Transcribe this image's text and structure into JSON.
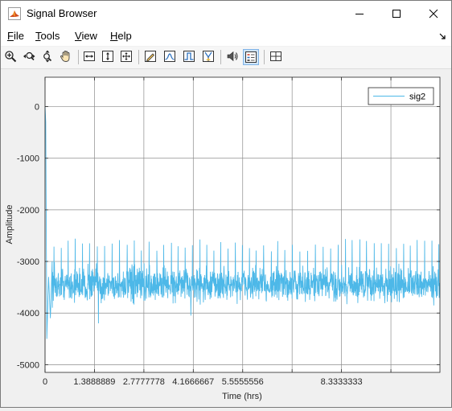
{
  "window": {
    "title": "Signal Browser",
    "controls": [
      "minimize",
      "maximize",
      "close"
    ]
  },
  "menu": {
    "items": [
      {
        "label": "File",
        "mnemonic": "F",
        "rest": "ile"
      },
      {
        "label": "Tools",
        "mnemonic": "T",
        "rest": "ools"
      },
      {
        "label": "View",
        "mnemonic": "V",
        "rest": "iew"
      },
      {
        "label": "Help",
        "mnemonic": "H",
        "rest": "elp"
      }
    ]
  },
  "toolbar": {
    "buttons": [
      "zoom-in-icon",
      "zoom-x-icon",
      "zoom-y-icon",
      "pan-icon",
      "fit-x-icon",
      "fit-y-icon",
      "fit-all-icon",
      "edit-icon",
      "peak-icon",
      "step-icon",
      "cursor-icon",
      "speaker-icon",
      "legend-icon",
      "layout-icon"
    ],
    "active": "legend-icon"
  },
  "chart_data": {
    "type": "line",
    "xlabel": "Time (hrs)",
    "ylabel": "Amplitude",
    "xlim": [
      0,
      11.1
    ],
    "ylim": [
      -5150,
      570
    ],
    "xticks": [
      0,
      1.3888889,
      2.7777778,
      4.1666667,
      5.5555556,
      8.3333333
    ],
    "xtick_labels": [
      "0",
      "1.3888889",
      "2.7777778",
      "4.1666667",
      "5.5555556",
      "8.3333333"
    ],
    "xgrid": [
      0,
      1.3888889,
      2.7777778,
      4.1666667,
      5.5555556,
      6.9444444,
      8.3333333,
      9.7222222
    ],
    "yticks": [
      0,
      -1000,
      -2000,
      -3000,
      -4000,
      -5000
    ],
    "ytick_labels": [
      "0",
      "-1000",
      "-2000",
      "-3000",
      "-4000",
      "-5000"
    ],
    "grid": true,
    "legend": {
      "placement": "top-right",
      "entries": [
        "sig2"
      ]
    },
    "series": [
      {
        "name": "sig2",
        "color": "#4db8e8",
        "description_of_shape": "initial spike near 0 at t=0, then noisy baseline around -3450 with periodic upward spikes to about -2550",
        "points": [
          [
            0.0,
            0
          ],
          [
            0.02,
            -300
          ],
          [
            0.05,
            -4500
          ],
          [
            0.1,
            -3300
          ],
          [
            0.15,
            -4100
          ],
          [
            0.2,
            -3000
          ],
          [
            0.3,
            -3400
          ],
          [
            0.4,
            -2620
          ],
          [
            0.5,
            -3500
          ],
          [
            0.6,
            -3200
          ],
          [
            0.7,
            -3800
          ],
          [
            0.8,
            -2700
          ],
          [
            1.0,
            -3450
          ],
          [
            1.2,
            -2600
          ],
          [
            1.3,
            -3550
          ],
          [
            1.45,
            -3400
          ],
          [
            1.5,
            -3900
          ],
          [
            1.6,
            -2650
          ],
          [
            1.8,
            -3450
          ],
          [
            2.0,
            -2600
          ],
          [
            2.2,
            -3500
          ],
          [
            2.4,
            -2650
          ],
          [
            2.6,
            -3450
          ],
          [
            2.8,
            -2600
          ],
          [
            3.0,
            -3500
          ],
          [
            3.2,
            -2650
          ],
          [
            3.4,
            -3450
          ],
          [
            3.6,
            -2600
          ],
          [
            3.8,
            -3450
          ],
          [
            4.0,
            -2650
          ],
          [
            4.1,
            -3800
          ],
          [
            4.2,
            -3500
          ],
          [
            4.4,
            -2600
          ],
          [
            4.6,
            -3450
          ],
          [
            4.8,
            -2650
          ],
          [
            5.0,
            -3450
          ],
          [
            5.2,
            -2600
          ],
          [
            5.4,
            -3500
          ],
          [
            5.6,
            -2650
          ],
          [
            5.8,
            -3450
          ],
          [
            6.0,
            -2600
          ],
          [
            6.2,
            -3500
          ],
          [
            6.4,
            -2650
          ],
          [
            6.6,
            -3450
          ],
          [
            6.8,
            -2600
          ],
          [
            7.0,
            -3450
          ],
          [
            7.2,
            -2650
          ],
          [
            7.4,
            -3500
          ],
          [
            7.6,
            -2600
          ],
          [
            7.8,
            -3450
          ],
          [
            8.0,
            -2650
          ],
          [
            8.2,
            -3450
          ],
          [
            8.4,
            -2600
          ],
          [
            8.6,
            -3500
          ],
          [
            8.8,
            -2650
          ],
          [
            9.0,
            -3450
          ],
          [
            9.2,
            -2600
          ],
          [
            9.4,
            -3500
          ],
          [
            9.6,
            -2650
          ],
          [
            9.8,
            -3450
          ],
          [
            10.0,
            -2600
          ],
          [
            10.2,
            -3500
          ],
          [
            10.4,
            -2650
          ],
          [
            10.6,
            -3450
          ],
          [
            10.8,
            -2600
          ],
          [
            11.0,
            -3500
          ],
          [
            11.1,
            -3400
          ]
        ]
      }
    ],
    "features": {
      "baseline": -3450,
      "noise_band": [
        -3900,
        -3050
      ],
      "spike_top": -2550,
      "spike_period_hrs": 0.2,
      "dips": [
        [
          1.5,
          -4200
        ],
        [
          4.1,
          -4050
        ]
      ]
    }
  }
}
